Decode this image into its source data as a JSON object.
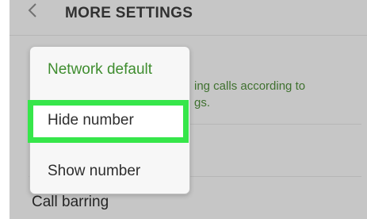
{
  "header": {
    "title": "MORE SETTINGS",
    "back_icon": "chevron-left-icon"
  },
  "background": {
    "caller_id_subtitle": "ing calls according to\ngs.",
    "call_barring_label": "Call barring"
  },
  "popup": {
    "items": [
      {
        "label": "Network default",
        "selected": true
      },
      {
        "label": "Hide number",
        "highlighted": true
      },
      {
        "label": "Show number"
      }
    ]
  },
  "colors": {
    "accent_green_text": "#3f8d2f",
    "highlight_border": "#36e64a",
    "background": "#f2f2f2"
  }
}
